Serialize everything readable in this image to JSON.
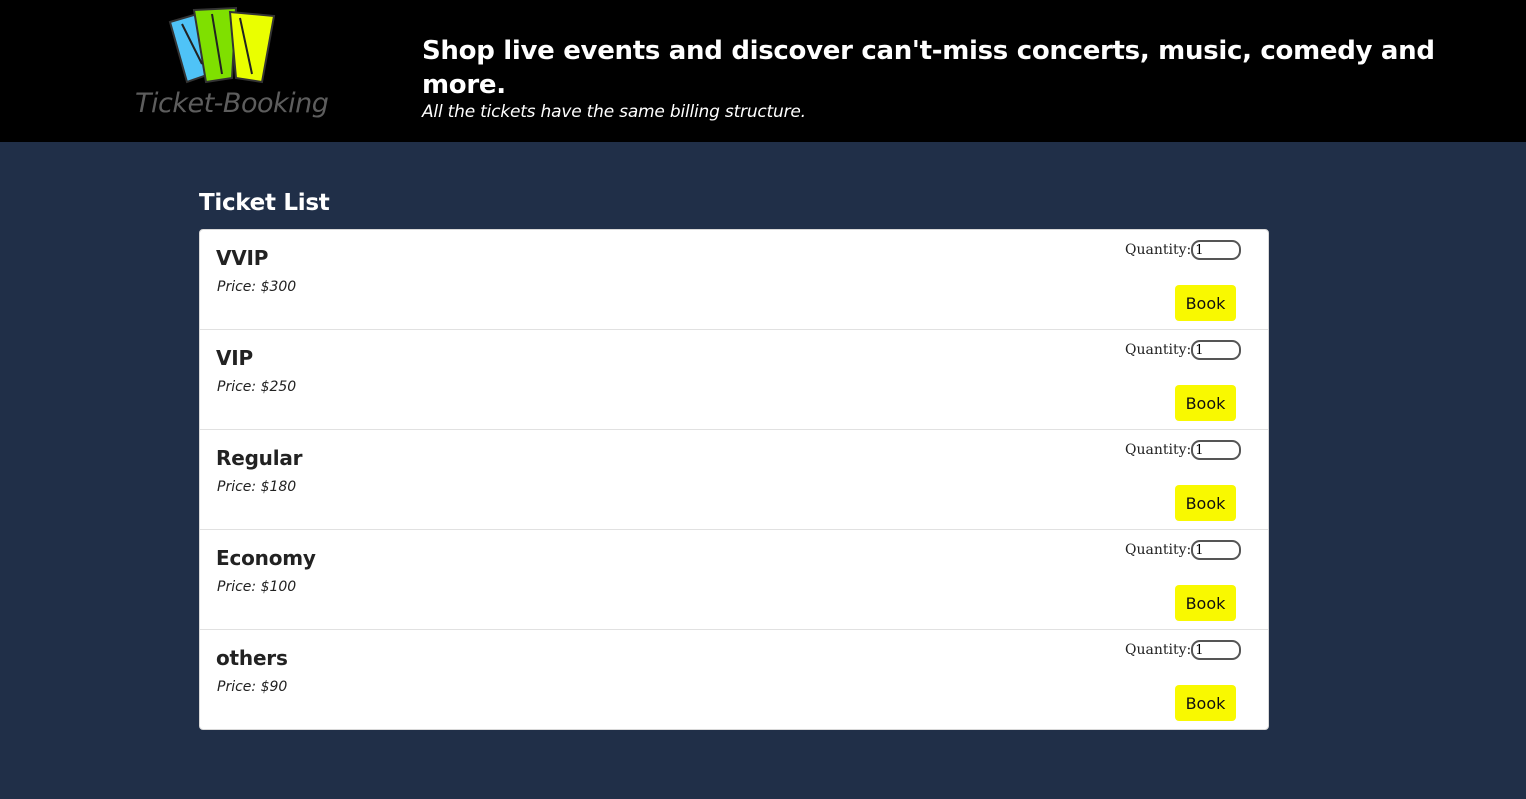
{
  "header": {
    "logo_text": "Ticket-Booking",
    "headline": "Shop live events and discover can't-miss concerts, music, comedy and more.",
    "subline": "All the tickets have the same billing structure."
  },
  "main": {
    "title": "Ticket List",
    "quantity_label": "Quantity:",
    "book_label": "Book",
    "tickets": [
      {
        "name": "VVIP",
        "price": "Price: $300",
        "quantity": "1"
      },
      {
        "name": "VIP",
        "price": "Price: $250",
        "quantity": "1"
      },
      {
        "name": "Regular",
        "price": "Price: $180",
        "quantity": "1"
      },
      {
        "name": "Economy",
        "price": "Price: $100",
        "quantity": "1"
      },
      {
        "name": "others",
        "price": "Price: $90",
        "quantity": "1"
      }
    ]
  },
  "colors": {
    "header_bg": "#000000",
    "page_bg": "#202f48",
    "button_bg": "#f9f900",
    "logo_blue": "#4fc3f7",
    "logo_green": "#7fe000",
    "logo_yellow": "#eaff00"
  }
}
